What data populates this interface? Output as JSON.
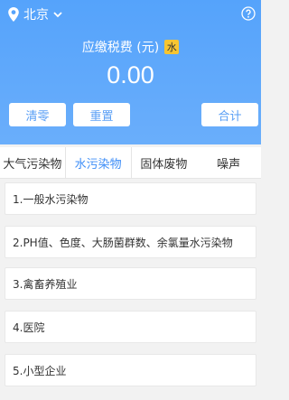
{
  "header": {
    "location": "北京",
    "title": "应缴税费 (元)",
    "badge": "水",
    "amount": "0.00"
  },
  "buttons": {
    "clear": "清零",
    "reset": "重置",
    "calculate": "合计"
  },
  "tabs": [
    {
      "label": "大气污染物"
    },
    {
      "label": "水污染物"
    },
    {
      "label": "固体废物"
    },
    {
      "label": "噪声"
    }
  ],
  "list": [
    {
      "label": "1.一般水污染物"
    },
    {
      "label": "2.PH值、色度、大肠菌群数、余氯量水污染物"
    },
    {
      "label": "3.禽畜养殖业"
    },
    {
      "label": "4.医院"
    },
    {
      "label": "5.小型企业"
    }
  ],
  "colors": {
    "header": "#55a3fb",
    "active_tab": "#3e8ef7",
    "badge": "#f7c531"
  }
}
